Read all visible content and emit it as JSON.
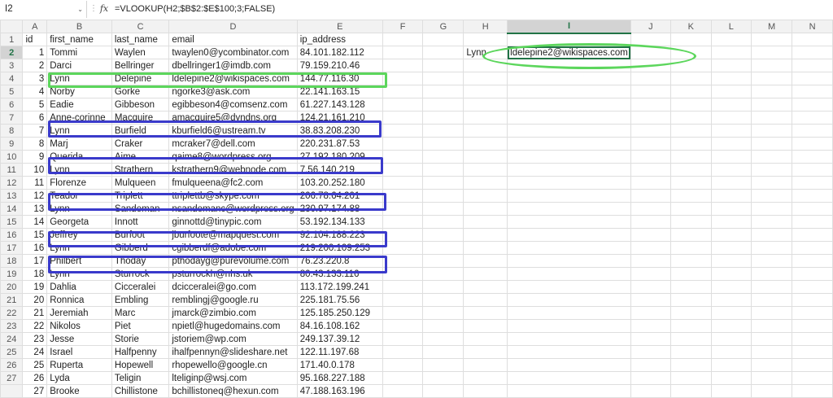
{
  "formula_bar": {
    "name_box": "I2",
    "chevron": "⌄",
    "fx_label": "fx",
    "dots": "⋮",
    "formula": "=VLOOKUP(H2;$B$2:$E$100;3;FALSE)"
  },
  "columns": [
    "A",
    "B",
    "C",
    "D",
    "E",
    "F",
    "G",
    "H",
    "I",
    "J",
    "K",
    "L",
    "M",
    "N"
  ],
  "row_numbers": [
    "1",
    "2",
    "3",
    "4",
    "5",
    "6",
    "7",
    "8",
    "9",
    "10",
    "11",
    "12",
    "13",
    "14",
    "15",
    "16",
    "17",
    "18",
    "19",
    "20",
    "21",
    "22",
    "23",
    "24",
    "25",
    "26",
    "27"
  ],
  "rows": [
    [
      "id",
      "first_name",
      "last_name",
      "email",
      "ip_address",
      "",
      "",
      "",
      "",
      "",
      "",
      "",
      "",
      ""
    ],
    [
      "1",
      "Tommi",
      "Waylen",
      "twaylen0@ycombinator.com",
      "84.101.182.112",
      "",
      "",
      "Lynn",
      "ldelepine2@wikispaces.com",
      "",
      "",
      "",
      "",
      ""
    ],
    [
      "2",
      "Darci",
      "Bellringer",
      "dbellringer1@imdb.com",
      "79.159.210.46",
      "",
      "",
      "",
      "",
      "",
      "",
      "",
      "",
      ""
    ],
    [
      "3",
      "Lynn",
      "Delepine",
      "ldelepine2@wikispaces.com",
      "144.77.116.30",
      "",
      "",
      "",
      "",
      "",
      "",
      "",
      "",
      ""
    ],
    [
      "4",
      "Norby",
      "Gorke",
      "ngorke3@ask.com",
      "22.141.163.15",
      "",
      "",
      "",
      "",
      "",
      "",
      "",
      "",
      ""
    ],
    [
      "5",
      "Eadie",
      "Gibbeson",
      "egibbeson4@comsenz.com",
      "61.227.143.128",
      "",
      "",
      "",
      "",
      "",
      "",
      "",
      "",
      ""
    ],
    [
      "6",
      "Anne-corinne",
      "Macquire",
      "amacquire5@dyndns.org",
      "124.21.161.210",
      "",
      "",
      "",
      "",
      "",
      "",
      "",
      "",
      ""
    ],
    [
      "7",
      "Lynn",
      "Burfield",
      "kburfield6@ustream.tv",
      "38.83.208.230",
      "",
      "",
      "",
      "",
      "",
      "",
      "",
      "",
      ""
    ],
    [
      "8",
      "Marj",
      "Craker",
      "mcraker7@dell.com",
      "220.231.87.53",
      "",
      "",
      "",
      "",
      "",
      "",
      "",
      "",
      ""
    ],
    [
      "9",
      "Querida",
      "Aime",
      "qaime8@wordpress.org",
      "27.192.180.209",
      "",
      "",
      "",
      "",
      "",
      "",
      "",
      "",
      ""
    ],
    [
      "10",
      "Lynn",
      "Strathern",
      "kstrathern9@webnode.com",
      "7.56.140.219",
      "",
      "",
      "",
      "",
      "",
      "",
      "",
      "",
      ""
    ],
    [
      "11",
      "Florenze",
      "Mulqueen",
      "fmulqueena@fc2.com",
      "103.20.252.180",
      "",
      "",
      "",
      "",
      "",
      "",
      "",
      "",
      ""
    ],
    [
      "12",
      "Teador",
      "Triplett",
      "ttriplettb@skype.com",
      "206.78.64.201",
      "",
      "",
      "",
      "",
      "",
      "",
      "",
      "",
      ""
    ],
    [
      "13",
      "Lynn",
      "Sandeman",
      "nsandemanc@wordpress.org",
      "230.97.174.88",
      "",
      "",
      "",
      "",
      "",
      "",
      "",
      "",
      ""
    ],
    [
      "14",
      "Georgeta",
      "Innott",
      "ginnottd@tinypic.com",
      "53.192.134.133",
      "",
      "",
      "",
      "",
      "",
      "",
      "",
      "",
      ""
    ],
    [
      "15",
      "Jeffrey",
      "Burfoot",
      "jburfoote@mapquest.com",
      "92.104.188.223",
      "",
      "",
      "",
      "",
      "",
      "",
      "",
      "",
      ""
    ],
    [
      "16",
      "Lynn",
      "Gibberd",
      "cgibberdf@adobe.com",
      "219.200.109.253",
      "",
      "",
      "",
      "",
      "",
      "",
      "",
      "",
      ""
    ],
    [
      "17",
      "Philbert",
      "Thoday",
      "pthodayg@purevolume.com",
      "76.23.220.8",
      "",
      "",
      "",
      "",
      "",
      "",
      "",
      "",
      ""
    ],
    [
      "18",
      "Lynn",
      "Sturrock",
      "psturrockh@nhs.uk",
      "80.43.133.116",
      "",
      "",
      "",
      "",
      "",
      "",
      "",
      "",
      ""
    ],
    [
      "19",
      "Dahlia",
      "Cicceralei",
      "dcicceralei@go.com",
      "113.172.199.241",
      "",
      "",
      "",
      "",
      "",
      "",
      "",
      "",
      ""
    ],
    [
      "20",
      "Ronnica",
      "Embling",
      "remblingj@google.ru",
      "225.181.75.56",
      "",
      "",
      "",
      "",
      "",
      "",
      "",
      "",
      ""
    ],
    [
      "21",
      "Jeremiah",
      "Marc",
      "jmarck@zimbio.com",
      "125.185.250.129",
      "",
      "",
      "",
      "",
      "",
      "",
      "",
      "",
      ""
    ],
    [
      "22",
      "Nikolos",
      "Piet",
      "npietl@hugedomains.com",
      "84.16.108.162",
      "",
      "",
      "",
      "",
      "",
      "",
      "",
      "",
      ""
    ],
    [
      "23",
      "Jesse",
      "Storie",
      "jstoriem@wp.com",
      "249.137.39.12",
      "",
      "",
      "",
      "",
      "",
      "",
      "",
      "",
      ""
    ],
    [
      "24",
      "Israel",
      "Halfpenny",
      "ihalfpennyn@slideshare.net",
      "122.11.197.68",
      "",
      "",
      "",
      "",
      "",
      "",
      "",
      "",
      ""
    ],
    [
      "25",
      "Ruperta",
      "Hopewell",
      "rhopewello@google.cn",
      "171.40.0.178",
      "",
      "",
      "",
      "",
      "",
      "",
      "",
      "",
      ""
    ],
    [
      "26",
      "Lyda",
      "Teligin",
      "lteliginp@wsj.com",
      "95.168.227.188",
      "",
      "",
      "",
      "",
      "",
      "",
      "",
      "",
      ""
    ],
    [
      "27",
      "Brooke",
      "Chillistone",
      "bchillistoneq@hexun.com",
      "47.188.163.196",
      "",
      "",
      "",
      "",
      "",
      "",
      "",
      "",
      ""
    ]
  ]
}
